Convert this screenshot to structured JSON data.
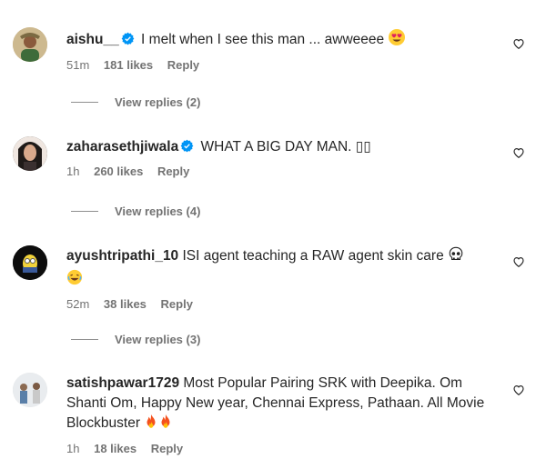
{
  "comments": [
    {
      "username": "aishu__",
      "verified": true,
      "text": "I melt when I see this man ... awweeee",
      "time": "51m",
      "likes": "181 likes",
      "reply": "Reply",
      "view_replies": "View replies (2)"
    },
    {
      "username": "zaharasethjiwala",
      "verified": true,
      "text": "WHAT A BIG DAY MAN. ▯▯",
      "time": "1h",
      "likes": "260 likes",
      "reply": "Reply",
      "view_replies": "View replies (4)"
    },
    {
      "username": "ayushtripathi_10",
      "verified": false,
      "text": "ISI agent teaching a RAW agent skin care",
      "time": "52m",
      "likes": "38 likes",
      "reply": "Reply",
      "view_replies": "View replies (3)"
    },
    {
      "username": "satishpawar1729",
      "verified": false,
      "text": "Most Popular Pairing SRK with Deepika. Om Shanti Om, Happy New year, Chennai Express, Pathaan. All Movie Blockbuster",
      "time": "1h",
      "likes": "18 likes",
      "reply": "Reply"
    }
  ],
  "colors": {
    "verified_blue": "#0095f6",
    "meta_gray": "#737373"
  }
}
